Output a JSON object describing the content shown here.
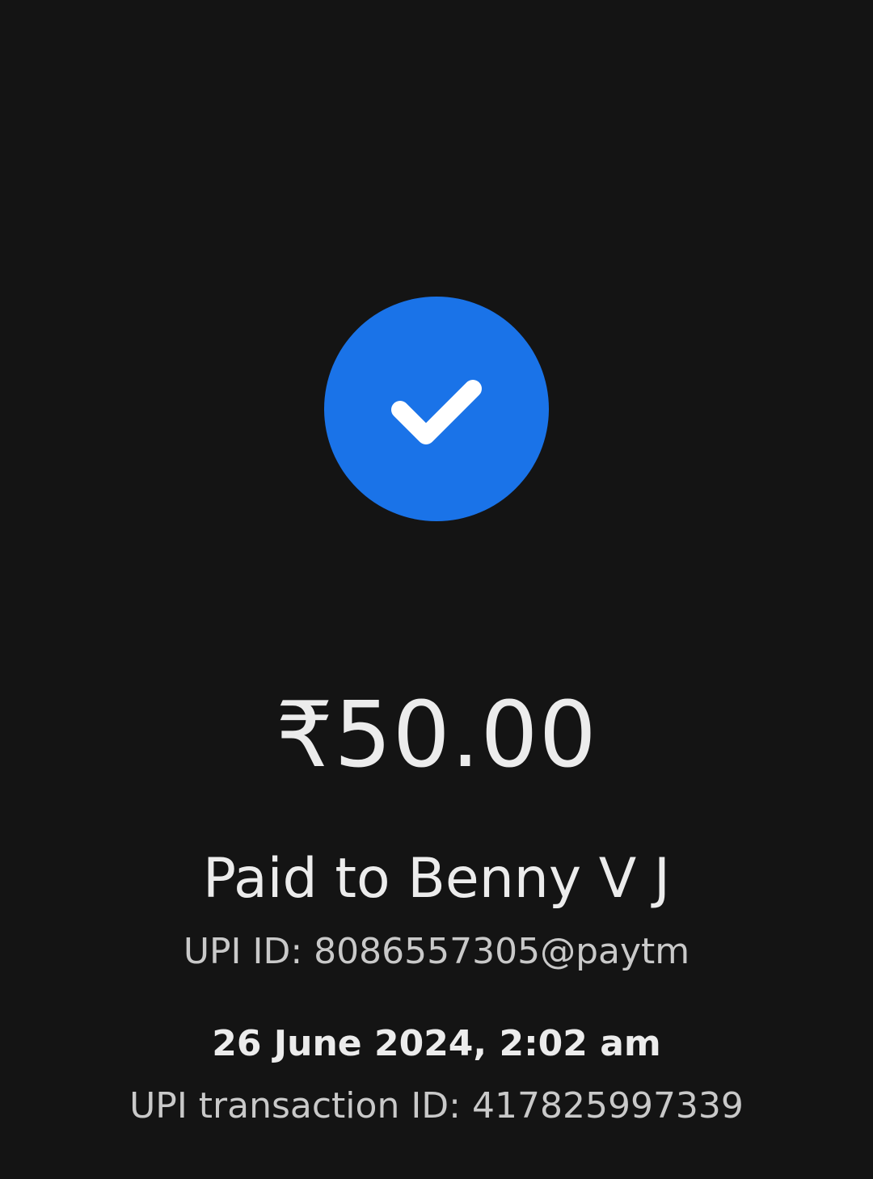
{
  "status": {
    "icon": "check-icon",
    "color": "#1a73e8"
  },
  "payment": {
    "amount": "₹50.00",
    "payee_line": "Paid to Benny V J",
    "upi_id_line": "UPI ID: 8086557305@paytm",
    "datetime": "26 June 2024, 2:02 am",
    "transaction_id_line": "UPI transaction ID: 417825997339"
  },
  "colors": {
    "background": "#141414",
    "primary_text": "#ececec",
    "secondary_text": "#c9c9c9"
  }
}
